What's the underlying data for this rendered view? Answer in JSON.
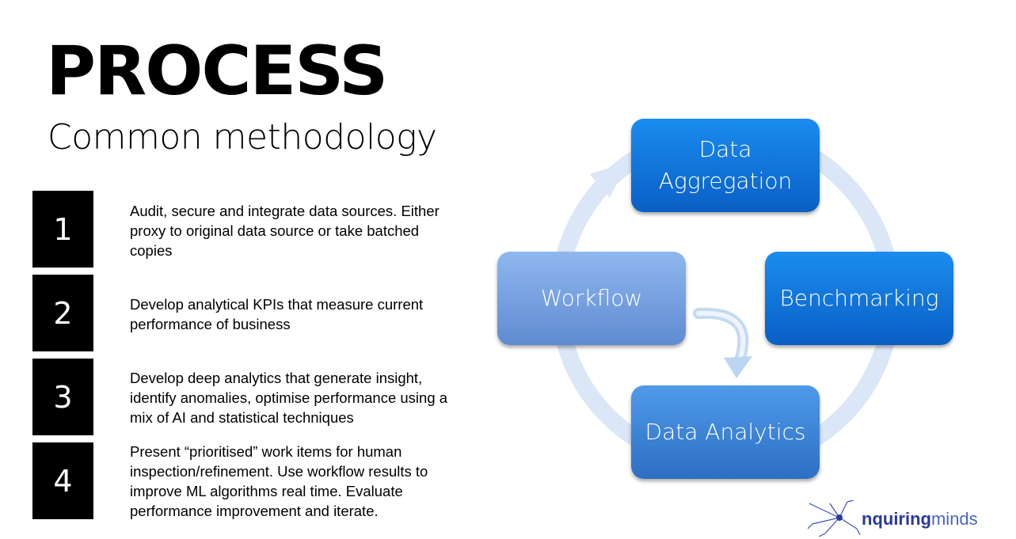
{
  "title": "PROCESS",
  "subtitle": "Common methodology",
  "steps": [
    {
      "number": "1",
      "text": "Audit, secure and integrate data sources. Either proxy to original data source or take batched copies"
    },
    {
      "number": "2",
      "text": "Develop analytical KPIs that measure current performance of business"
    },
    {
      "number": "3",
      "text": "Develop deep analytics that generate insight, identify anomalies, optimise performance  using a mix of AI and statistical techniques"
    },
    {
      "number": "4",
      "text": "Present “prioritised” work items for human inspection/refinement. Use workflow results to improve ML algorithms real time. Evaluate performance improvement and iterate."
    }
  ],
  "cycle": {
    "nodes": [
      "Data\nAggregation",
      "Benchmarking",
      "Data Analytics",
      "Workflow"
    ]
  },
  "logo": {
    "bold": "nquiring",
    "light": "minds"
  },
  "colors": {
    "node_blue": "#1a8cf0",
    "node_light": "#8fb7ef",
    "ring": "#dbe6f6"
  }
}
